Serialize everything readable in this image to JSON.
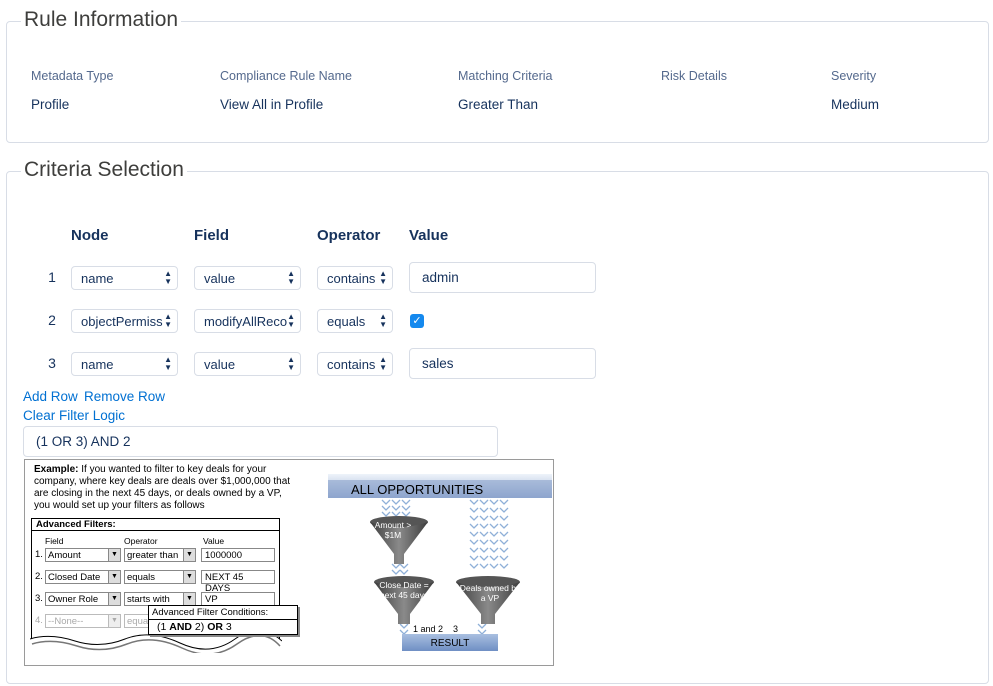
{
  "rule_info": {
    "title": "Rule Information",
    "columns": [
      {
        "label": "Metadata Type",
        "value": "Profile"
      },
      {
        "label": "Compliance Rule Name",
        "value": "View All in Profile"
      },
      {
        "label": "Matching Criteria",
        "value": "Greater Than"
      },
      {
        "label": "Risk Details",
        "value": ""
      },
      {
        "label": "Severity",
        "value": "Medium"
      }
    ]
  },
  "criteria": {
    "title": "Criteria Selection",
    "headers": {
      "node": "Node",
      "field": "Field",
      "operator": "Operator",
      "value": "Value"
    },
    "rows": [
      {
        "num": "1",
        "node": "name",
        "field": "value",
        "operator": "contains",
        "value": "admin"
      },
      {
        "num": "2",
        "node": "objectPermiss",
        "field": "modifyAllReco",
        "operator": "equals",
        "checked": true
      },
      {
        "num": "3",
        "node": "name",
        "field": "value",
        "operator": "contains",
        "value": "sales"
      }
    ],
    "add_row": "Add Row",
    "remove_row": "Remove Row",
    "clear_filter_logic": "Clear Filter Logic",
    "filter_logic": "(1 OR 3) AND 2"
  },
  "example": {
    "bold_lead": "Example:",
    "text": " If you wanted to filter to key deals for your company, where key deals are deals over $1,000,000 that are closing in the next 45 days, or deals owned by a VP, you would set up your filters as follows",
    "adv_filters_title": "Advanced Filters:",
    "col_field": "Field",
    "col_operator": "Operator",
    "col_value": "Value",
    "rows": [
      {
        "num": "1.",
        "field": "Amount",
        "operator": "greater than",
        "value": "1000000"
      },
      {
        "num": "2.",
        "field": "Closed Date",
        "operator": "equals",
        "value": "NEXT 45 DAYS"
      },
      {
        "num": "3.",
        "field": "Owner Role",
        "operator": "starts with",
        "value": "VP"
      },
      {
        "num": "4.",
        "field": "--None--",
        "operator": "equa",
        "value": ""
      }
    ],
    "adv_conditions_title": "Advanced Filter Conditions:",
    "adv_conditions_pre": "(1 ",
    "adv_conditions_and": "AND",
    "adv_conditions_mid": " 2) ",
    "adv_conditions_or": "OR",
    "adv_conditions_post": " 3",
    "funnel_title": "ALL OPPORTUNITIES",
    "funnel_amount": "Amount > $1M",
    "funnel_close": "Close Date = next 45 days",
    "funnel_owned": "Deals owned by a VP",
    "label_1and2": "1 and 2",
    "label_3": "3",
    "result": "RESULT"
  },
  "colors": {
    "link": "#0070d2",
    "checkbox": "#1589ee",
    "text": "#16325c"
  }
}
